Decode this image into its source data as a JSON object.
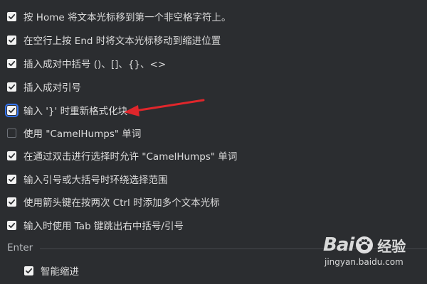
{
  "options": [
    {
      "label": "按 Home 将文本光标移到第一个非空格字符上。",
      "checked": true
    },
    {
      "label": "在空行上按 End 时将文本光标移动到缩进位置",
      "checked": true
    },
    {
      "label": "插入成对中括号 ()、[]、{}、<>",
      "checked": true
    },
    {
      "label": "插入成对引号",
      "checked": true
    },
    {
      "label": "输入 '}' 时重新格式化块",
      "checked": true,
      "focused": true
    },
    {
      "label": "使用 \"CamelHumps\" 单词",
      "checked": false
    },
    {
      "label": "在通过双击进行选择时允许 \"CamelHumps\" 单词",
      "checked": true
    },
    {
      "label": "输入引号或大括号时环绕选择范围",
      "checked": true
    },
    {
      "label": "使用箭头键在按两次 Ctrl 时添加多个文本光标",
      "checked": true
    },
    {
      "label": "输入时使用 Tab 键跳出右中括号/引号",
      "checked": true
    }
  ],
  "enter_section": {
    "title": "Enter",
    "options": [
      {
        "label": "智能缩进",
        "checked": true
      }
    ]
  },
  "watermark": {
    "brand": "Bai",
    "brand_suffix": "经验",
    "url": "jingyan.baidu.com"
  },
  "colors": {
    "background": "#2b2d30",
    "text": "#dcdcdc",
    "checkbox_checked": "#f2f2f2",
    "focus_ring": "#3574f0",
    "annotation_arrow": "#e0262b"
  }
}
